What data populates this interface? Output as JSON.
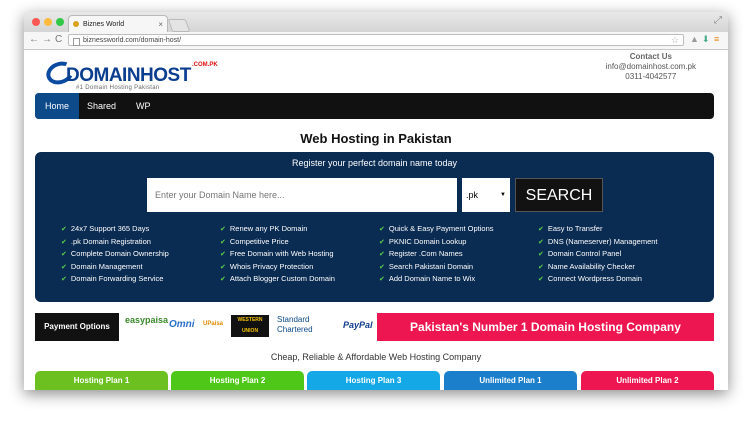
{
  "browser": {
    "tab_title": "Biznes World",
    "tab_close": "×",
    "url": "biznessworld.com/domain-host/",
    "back": "←",
    "forward": "→",
    "reload": "C",
    "star": "☆",
    "menu": "≡",
    "resize": "⤢"
  },
  "header": {
    "logo_text": "DOMAINHOST",
    "logo_tld": ".COM.PK",
    "logo_tagline": "#1 Domain Hosting Pakistan",
    "contact_title": "Contact Us",
    "contact_email": "info@domainhost.com.pk",
    "contact_phone": "0311-4042577"
  },
  "nav": {
    "items": [
      {
        "label": "Home"
      },
      {
        "label": "Shared"
      },
      {
        "label": "WP"
      }
    ]
  },
  "main": {
    "heading": "Web Hosting in Pakistan",
    "search": {
      "subtitle": "Register your perfect domain name today",
      "placeholder": "Enter your Domain Name here...",
      "tld_value": ".pk",
      "tld_chevron": "▼",
      "button": "SEARCH"
    },
    "features": [
      [
        "24x7 Support 365 Days",
        ".pk Domain Registration",
        "Complete Domain Ownership",
        "Domain Management",
        "Domain Forwarding Service"
      ],
      [
        "Renew any PK Domain",
        "Competitive Price",
        "Free Domain with Web Hosting",
        "Whois Privacy Protection",
        "Attach Blogger Custom Domain"
      ],
      [
        "Quick & Easy Payment Options",
        "PKNIC Domain Lookup",
        "Register .Com Names",
        "Search Pakistani Domain",
        "Add Domain Name to Wix"
      ],
      [
        "Easy to Transfer",
        "DNS (Nameserver) Management",
        "Domain Control Panel",
        "Name Availability Checker",
        "Connect Wordpress Domain"
      ]
    ],
    "check": "✔",
    "payment": {
      "label": "Payment Options",
      "logos": [
        "easypaisa",
        "Omni",
        "UPaisa",
        "WESTERN UNION",
        "Standard Chartered",
        "PayPal"
      ]
    },
    "banner": "Pakistan's Number 1 Domain Hosting Company",
    "tagline": "Cheap, Reliable & Affordable Web Hosting Company",
    "plans": [
      {
        "label": "Hosting Plan 1",
        "color": "#6cc020"
      },
      {
        "label": "Hosting Plan 2",
        "color": "#4fc718"
      },
      {
        "label": "Hosting Plan 3",
        "color": "#14a9e6"
      },
      {
        "label": "Unlimited Plan 1",
        "color": "#1c7fcc"
      },
      {
        "label": "Unlimited Plan 2",
        "color": "#ee1651"
      }
    ]
  },
  "colors": {
    "brand_blue": "#0b3e8f",
    "panel": "#0a2b52",
    "nav_active": "#0c4a8a",
    "accent_pink": "#ee1651"
  }
}
